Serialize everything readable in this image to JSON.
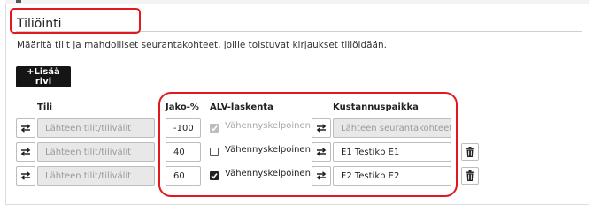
{
  "section": {
    "title": "Tiliöinti",
    "description": "Määritä tilit ja mahdolliset seurantakohteet, joille toistuvat kirjaukset tiliöidään.",
    "add_row_label": "+Lisää rivi"
  },
  "columns": {
    "account": "Tili",
    "share": "Jako-%",
    "vat": "ALV-laskenta",
    "cost_center": "Kustannuspaikka"
  },
  "rows": [
    {
      "account_placeholder": "Lähteen tilit/tilivälit",
      "share": "-100",
      "vat_label": "Vähennyskelpoinen",
      "vat_checked": true,
      "vat_disabled": true,
      "cost_center": "Lähteen seurantakohteet",
      "cost_center_disabled": true,
      "has_delete": false
    },
    {
      "account_placeholder": "Lähteen tilit/tilivälit",
      "share": "40",
      "vat_label": "Vähennyskelpoinen",
      "vat_checked": false,
      "vat_disabled": false,
      "cost_center": "E1 Testikp E1",
      "cost_center_disabled": false,
      "has_delete": true
    },
    {
      "account_placeholder": "Lähteen tilit/tilivälit",
      "share": "60",
      "vat_label": "Vähennyskelpoinen",
      "vat_checked": true,
      "vat_disabled": false,
      "cost_center": "E2 Testikp E2",
      "cost_center_disabled": false,
      "has_delete": true
    }
  ],
  "icons": {
    "swap": "swap-arrows-icon",
    "delete": "trash-icon",
    "check": "checkmark-icon"
  },
  "colors": {
    "annotation": "#e0191e",
    "primary_button": "#151515"
  }
}
